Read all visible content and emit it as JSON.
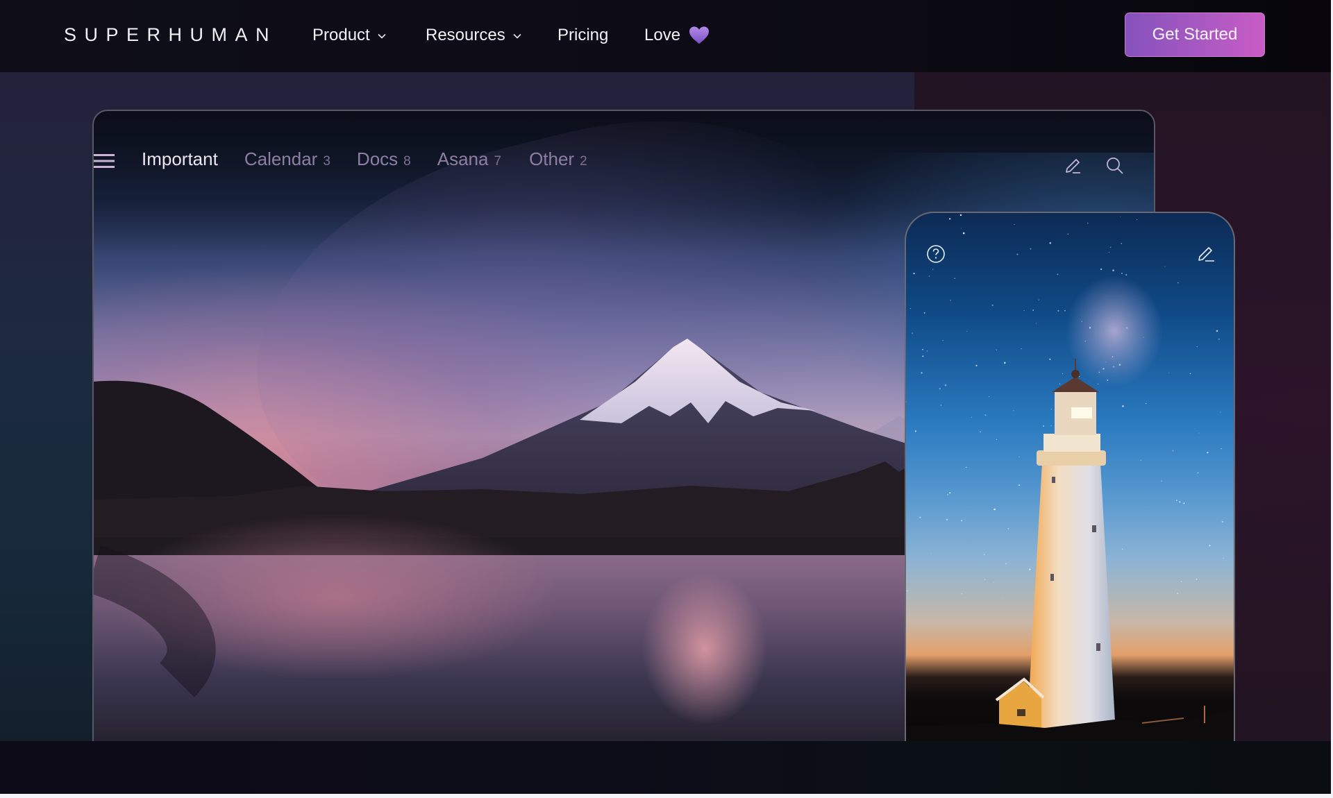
{
  "nav": {
    "logo": "SUPERHUMAN",
    "items": [
      {
        "label": "Product",
        "has_dropdown": true
      },
      {
        "label": "Resources",
        "has_dropdown": true
      },
      {
        "label": "Pricing",
        "has_dropdown": false
      },
      {
        "label": "Love",
        "has_dropdown": false,
        "icon": "purple-heart-icon"
      }
    ],
    "cta_label": "Get Started",
    "cta_gradient": [
      "#8552bb",
      "#c95cc5"
    ]
  },
  "desktop_app": {
    "menu_icon": "hamburger-icon",
    "tabs": [
      {
        "label": "Important",
        "count": "",
        "active": true
      },
      {
        "label": "Calendar",
        "count": "3",
        "active": false
      },
      {
        "label": "Docs",
        "count": "8",
        "active": false
      },
      {
        "label": "Asana",
        "count": "7",
        "active": false
      },
      {
        "label": "Other",
        "count": "2",
        "active": false
      }
    ],
    "actions": [
      "compose-icon",
      "search-icon"
    ],
    "background_image": "mountain-lake-sunset"
  },
  "mobile_app": {
    "left_icon": "help-icon",
    "right_icon": "compose-icon",
    "background_image": "lighthouse-starry-sky"
  },
  "colors": {
    "nav_bg": "#0f0e18",
    "tab_active": "#ece6f0",
    "tab_inactive": "#8f7ea4",
    "heart": "#9a6bd8"
  }
}
